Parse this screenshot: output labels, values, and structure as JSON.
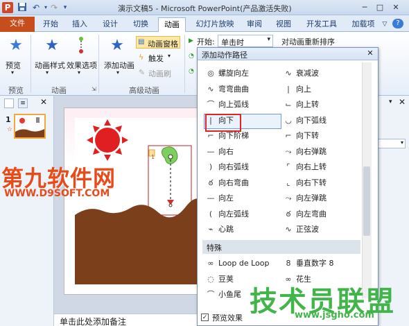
{
  "window": {
    "title": "演示文稿5 - Microsoft PowerPoint(产品激活失败)",
    "minimize": "─",
    "maximize": "□",
    "close": "✕"
  },
  "qat": {
    "app_icon": "P",
    "save_icon": "save-icon",
    "undo_icon": "undo-icon",
    "redo_icon": "redo-icon"
  },
  "tabs": [
    "文件",
    "开始",
    "插入",
    "设计",
    "切换",
    "动画",
    "幻灯片放映",
    "审阅",
    "视图",
    "开发工具",
    "加载项"
  ],
  "active_tab": "动画",
  "ribbon": {
    "preview": "预览",
    "animation_style": "动画样式",
    "effect_options": "效果选项",
    "add_animation": "添加动画",
    "animation_pane": "动画窗格",
    "trigger": "触发",
    "animation_painter": "动画刷",
    "start_label": "开始:",
    "start_value": "单击时",
    "reorder_label": "对动画重新排序",
    "groups": {
      "preview": "预览",
      "animation": "动画",
      "advanced": "高级动画"
    }
  },
  "thumbnail": {
    "number": "1"
  },
  "notes_placeholder": "单击此处添加备注",
  "dialog": {
    "title": "添加动作路径",
    "close": "✕",
    "left_column": [
      {
        "label": "螺旋向左",
        "icon": "◎"
      },
      {
        "label": "弯弯曲曲",
        "icon": "∿"
      },
      {
        "label": "向上弧线",
        "icon": "⌒"
      },
      {
        "label": "向下",
        "icon": "|"
      },
      {
        "label": "向下阶梯",
        "icon": "⌐"
      },
      {
        "label": "向右",
        "icon": "—"
      },
      {
        "label": "向右弧线",
        "icon": ")"
      },
      {
        "label": "向右弯曲",
        "icon": "ఠ"
      },
      {
        "label": "向左",
        "icon": "—"
      },
      {
        "label": "向左弧线",
        "icon": "("
      },
      {
        "label": "心跳",
        "icon": "⌁"
      }
    ],
    "right_column": [
      {
        "label": "衰减波",
        "icon": "∿"
      },
      {
        "label": "向上",
        "icon": "|"
      },
      {
        "label": "向上转",
        "icon": "⌙"
      },
      {
        "label": "向下弧线",
        "icon": "◡"
      },
      {
        "label": "向下转",
        "icon": "⌐"
      },
      {
        "label": "向右弹跳",
        "icon": "⤳"
      },
      {
        "label": "向右上转",
        "icon": "⌜"
      },
      {
        "label": "向右下转",
        "icon": "⌞"
      },
      {
        "label": "向左弹跳",
        "icon": "⤳"
      },
      {
        "label": "向左弯曲",
        "icon": "ఠ"
      },
      {
        "label": "正弦波",
        "icon": "∿"
      }
    ],
    "special_header": "特殊",
    "special_left": [
      {
        "label": "Loop de Loop",
        "icon": "∞"
      },
      {
        "label": "豆荚",
        "icon": "◌"
      },
      {
        "label": "小鱼尾",
        "icon": "⌒"
      }
    ],
    "special_right": [
      {
        "label": "垂直数字 8",
        "icon": "8"
      },
      {
        "label": "花生",
        "icon": "∞"
      }
    ],
    "preview_checkbox": "预览效果",
    "preview_checked": true
  },
  "watermarks": {
    "left": "第九软件网",
    "left_url": "WWW.D9SOFT.COM",
    "right": "技术员联盟",
    "right_url": "www.jsgho.com"
  },
  "colors": {
    "file_tab": "#c74d1c",
    "selection_highlight": "#e02424",
    "watermark_left": "#e84a1a",
    "watermark_right": "#41b44a"
  }
}
